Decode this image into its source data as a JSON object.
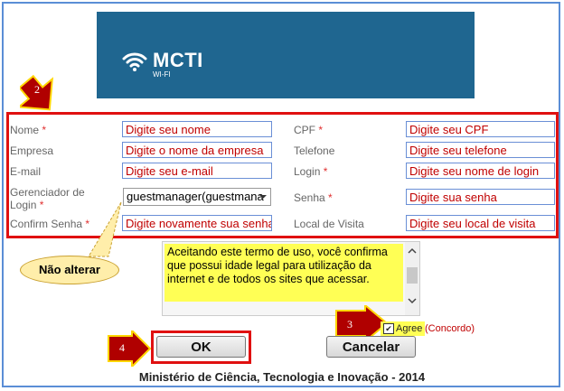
{
  "banner": {
    "brand": "MCTI",
    "sub": "WI-FI",
    "color": "#1f6690"
  },
  "badges": {
    "form": "2",
    "agree": "3",
    "ok": "4"
  },
  "fields": {
    "nome": {
      "label": "Nome",
      "req": "*",
      "value": "Digite seu nome"
    },
    "empresa": {
      "label": "Empresa",
      "value": "Digite o nome da empresa"
    },
    "email": {
      "label": "E-mail",
      "value": "Digite seu e-mail"
    },
    "gerenciador": {
      "label1": "Gerenciador de",
      "label2": "Login",
      "req": "*",
      "value": "guestmanager(guestmana"
    },
    "confirm": {
      "label": "Confirm Senha",
      "req": "*",
      "value": "Digite novamente sua senha"
    },
    "cpf": {
      "label": "CPF",
      "req": "*",
      "value": "Digite seu CPF"
    },
    "telefone": {
      "label": "Telefone",
      "value": "Digite seu telefone"
    },
    "login": {
      "label": "Login",
      "req": "*",
      "value": "Digite seu nome de login"
    },
    "senha": {
      "label": "Senha",
      "req": "*",
      "value": "Digite sua senha"
    },
    "local": {
      "label": "Local de Visita",
      "value": "Digite seu local de visita"
    }
  },
  "callout": "Não alterar",
  "terms": "Aceitando este termo de uso, você confirma que possui idade legal para utilização da internet e de todos os sites que acessar.",
  "agree": {
    "checked": "✔",
    "label": "Agree",
    "note": "(Concordo)"
  },
  "buttons": {
    "ok": "OK",
    "cancel": "Cancelar"
  },
  "footer": "Ministério de Ciência, Tecnologia e Inovação - 2014"
}
